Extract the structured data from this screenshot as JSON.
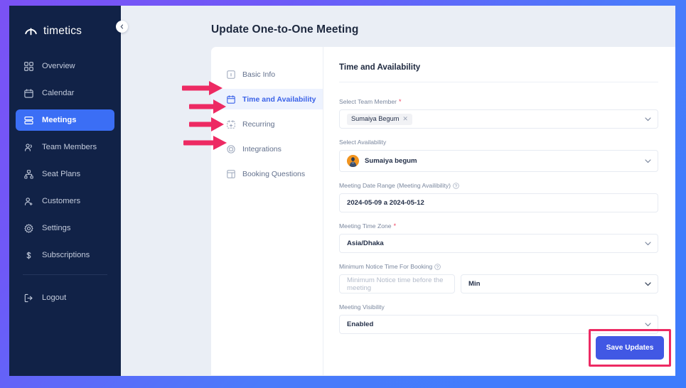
{
  "theme": {
    "frame_gradient_start": "#7b52f5",
    "frame_gradient_end": "#3b7cfc",
    "sidebar_bg": "#112247",
    "sidebar_active_bg": "#3b6ef5",
    "page_bg": "#eaeef5",
    "card_bg": "#ffffff",
    "accent_blue": "#4158e4",
    "tab_active_text": "#3b63e8",
    "tab_active_bg": "#edf2fe",
    "annotation_red": "#ed2a63",
    "required_star": "#f0415f",
    "avatar_bg": "#f1941f"
  },
  "sidebar": {
    "brand": "timetics",
    "brand_icon": "timetics-logo-icon",
    "collapse_icon": "chevron-left-icon",
    "items": [
      {
        "label": "Overview",
        "icon": "grid-icon",
        "active": false
      },
      {
        "label": "Calendar",
        "icon": "calendar-icon",
        "active": false
      },
      {
        "label": "Meetings",
        "icon": "meetings-icon",
        "active": true
      },
      {
        "label": "Team Members",
        "icon": "users-icon",
        "active": false
      },
      {
        "label": "Seat Plans",
        "icon": "seatplan-icon",
        "active": false
      },
      {
        "label": "Customers",
        "icon": "user-add-icon",
        "active": false
      },
      {
        "label": "Settings",
        "icon": "gear-icon",
        "active": false
      },
      {
        "label": "Subscriptions",
        "icon": "dollar-icon",
        "active": false
      }
    ],
    "bottom_items": [
      {
        "label": "Logout",
        "icon": "logout-icon",
        "active": false
      }
    ]
  },
  "header": {
    "title": "Update One-to-One Meeting"
  },
  "tabs": [
    {
      "label": "Basic Info",
      "icon": "info-box-icon",
      "active": false,
      "annotated": false
    },
    {
      "label": "Time and Availability",
      "icon": "calendar-icon",
      "active": true,
      "annotated": true
    },
    {
      "label": "Recurring",
      "icon": "calendar-plus-icon",
      "active": false,
      "annotated": true
    },
    {
      "label": "Integrations",
      "icon": "integration-icon",
      "active": false,
      "annotated": true
    },
    {
      "label": "Booking Questions",
      "icon": "form-layout-icon",
      "active": false,
      "annotated": true
    }
  ],
  "form": {
    "heading": "Time and Availability",
    "fields": {
      "team_member": {
        "label": "Select Team Member",
        "required": true,
        "chip_value": "Sumaiya Begum",
        "chip_remove_icon": "close-icon",
        "caret_icon": "chevron-down-icon"
      },
      "availability": {
        "label": "Select Availability",
        "required": false,
        "value": "Sumaiya begum",
        "avatar_icon": "user-avatar-icon",
        "caret_icon": "chevron-down-icon"
      },
      "date_range": {
        "label": "Meeting Date Range (Meeting Availibility)",
        "required": false,
        "help_icon": "question-mark-icon",
        "value": "2024-05-09 a 2024-05-12"
      },
      "time_zone": {
        "label": "Meeting Time Zone",
        "required": true,
        "value": "Asia/Dhaka",
        "caret_icon": "chevron-down-icon"
      },
      "minimum_notice": {
        "label": "Minimum Notice Time For Booking",
        "required": false,
        "help_icon": "question-mark-icon",
        "input_placeholder": "Minimum Notice time before the meeting",
        "input_value": "",
        "unit_value": "Min",
        "caret_icon": "chevron-down-icon"
      },
      "visibility": {
        "label": "Meeting Visibility",
        "required": false,
        "value": "Enabled",
        "caret_icon": "chevron-down-icon"
      }
    },
    "save_label": "Save Updates"
  },
  "annotations": {
    "arrow_icon": "right-arrow-icon",
    "arrow_count": 4,
    "highlight_target": "Save Updates"
  }
}
